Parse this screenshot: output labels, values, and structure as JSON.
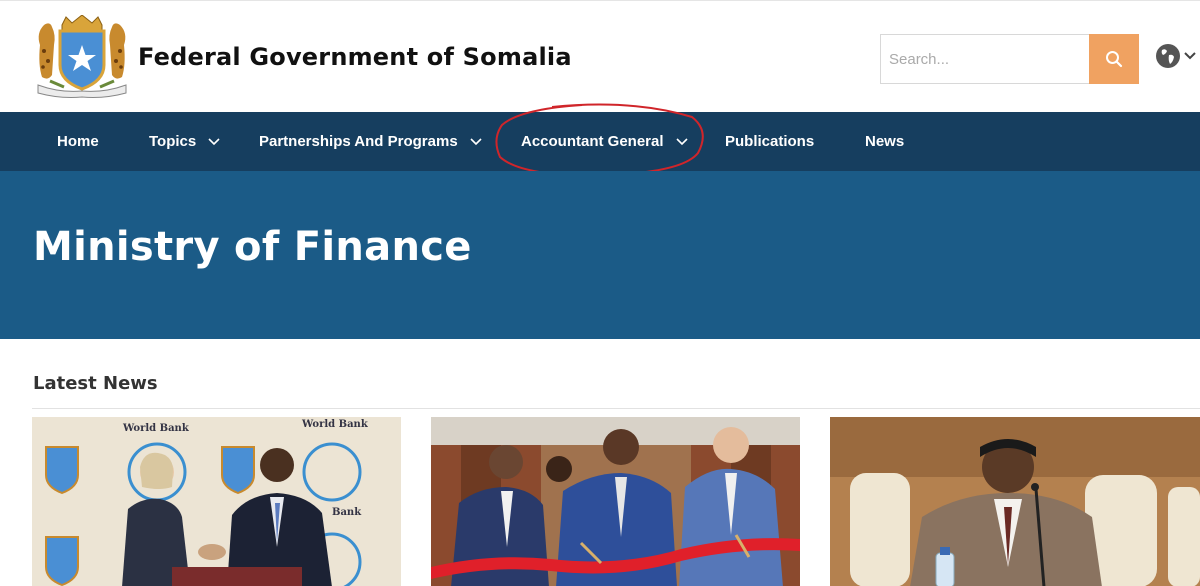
{
  "header": {
    "site_title": "Federal Government of Somalia",
    "search_placeholder": "Search...",
    "search_value": ""
  },
  "nav": {
    "items": [
      {
        "label": "Home",
        "has_dropdown": false
      },
      {
        "label": "Topics",
        "has_dropdown": true
      },
      {
        "label": "Partnerships And Programs",
        "has_dropdown": true
      },
      {
        "label": "Accountant General",
        "has_dropdown": true,
        "annotated": true
      },
      {
        "label": "Publications",
        "has_dropdown": false
      },
      {
        "label": "News",
        "has_dropdown": false
      }
    ]
  },
  "hero": {
    "title": "Ministry of Finance"
  },
  "latest_news": {
    "heading": "Latest News",
    "cards": [
      {
        "photo_text_1": "World Bank",
        "photo_text_2": "World Bank",
        "photo_text_3": "Bank"
      },
      {},
      {}
    ]
  },
  "colors": {
    "nav_bg": "#163e5f",
    "hero_bg": "#1b5b87",
    "search_button": "#f0a261",
    "annotation": "#d0252a"
  }
}
